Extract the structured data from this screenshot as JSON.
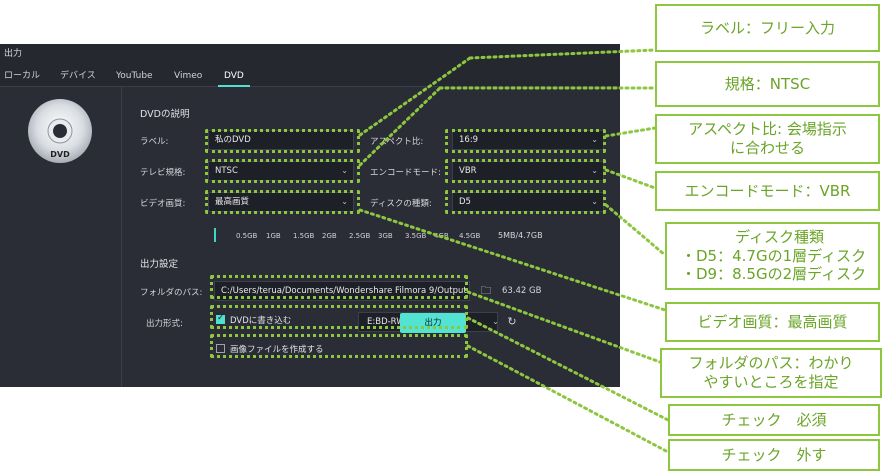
{
  "dialog": {
    "title": "出力",
    "tabs": [
      "ローカル",
      "デバイス",
      "YouTube",
      "Vimeo",
      "DVD"
    ],
    "active_tab": "DVD"
  },
  "dvd": {
    "section_title": "DVDの説明",
    "label_label": "ラベル:",
    "label_value": "私のDVD",
    "aspect_label": "アスペクト比:",
    "aspect_value": "16:9",
    "tv_label": "テレビ規格:",
    "tv_value": "NTSC",
    "encode_label": "エンコードモード:",
    "encode_value": "VBR",
    "quality_label": "ビデオ画質:",
    "quality_value": "最高画質",
    "disc_label": "ディスクの種類:",
    "disc_value": "D5",
    "capacity_ticks": [
      "0.5GB",
      "1GB",
      "1.5GB",
      "2GB",
      "2.5GB",
      "3GB",
      "3.5GB",
      "4GB",
      "4.5GB"
    ],
    "capacity_size": "5MB/4.7GB"
  },
  "output": {
    "section_title": "出力設定",
    "folder_label": "フォルダのパス:",
    "folder_value": "C:/Users/terua/Documents/Wondershare Filmora 9/Output",
    "free_space": "63.42 GB",
    "format_label": "出力形式:",
    "burn_dvd_label": "DVDに書き込む",
    "burn_dvd_checked": true,
    "drive_value": "E:BD-RW   BDR-UD04",
    "iso_label": "画像ファイルを作成する",
    "iso_checked": false,
    "export_button": "出力"
  },
  "callouts": {
    "label": "ラベル：フリー入力",
    "standard": "規格：NTSC",
    "aspect": [
      "アスペクト比: 会場指示",
      "に合わせる"
    ],
    "encode": "エンコードモード：VBR",
    "disc": [
      "ディスク種類",
      "・D5：4.7Gの1層ディスク",
      "・D9：8.5Gの2層ディスク"
    ],
    "quality": "ビデオ画質：最高画質",
    "folder": [
      "フォルダのパス：わかり",
      "やすいところを指定"
    ],
    "check_required": "チェック　必須",
    "check_off": "チェック　外す"
  },
  "colors": {
    "annotation": "#8dc63f",
    "annotation_text": "#6aa428",
    "accent": "#4fe0d0",
    "panel": "#2a2d35"
  }
}
